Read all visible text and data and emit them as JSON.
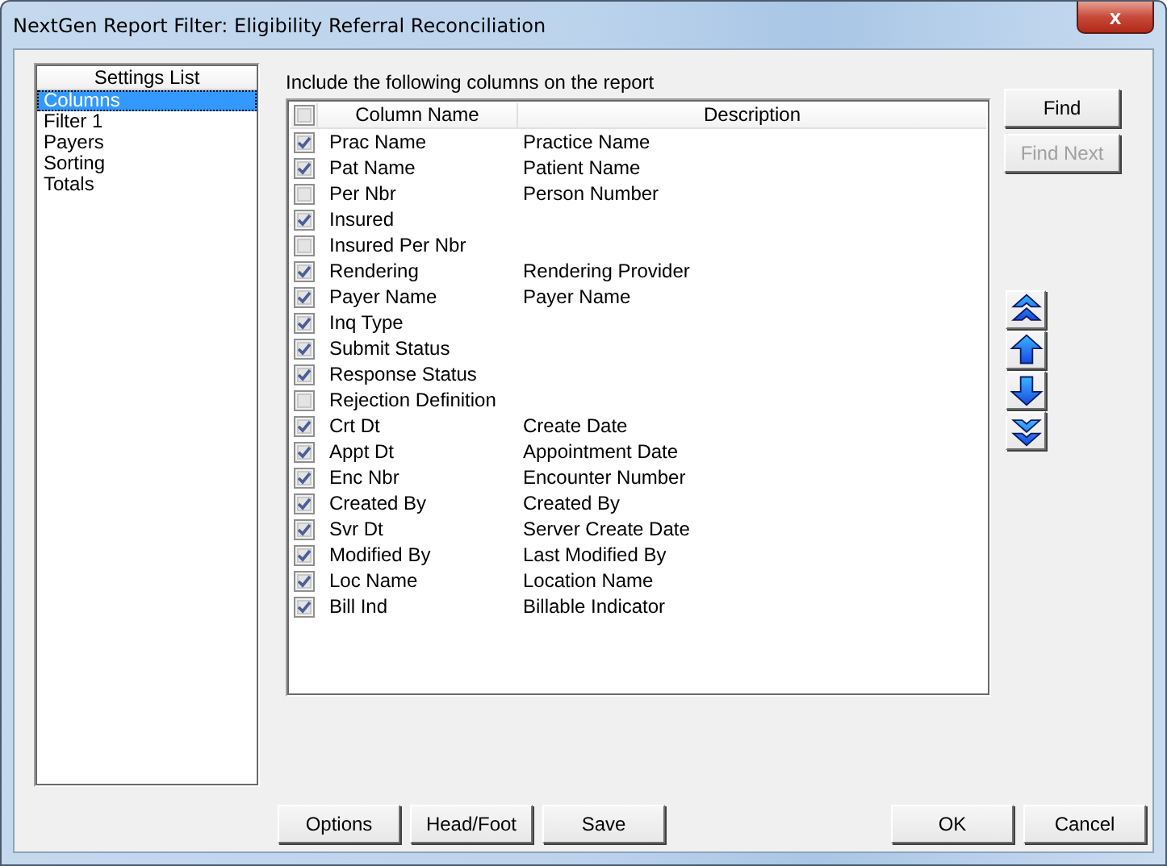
{
  "window": {
    "title": "NextGen Report Filter: Eligibility Referral Reconciliation",
    "close": "x"
  },
  "settings_list": {
    "header": "Settings List",
    "items": [
      {
        "label": "Columns",
        "selected": true
      },
      {
        "label": "Filter 1",
        "selected": false
      },
      {
        "label": "Payers",
        "selected": false
      },
      {
        "label": "Sorting",
        "selected": false
      },
      {
        "label": "Totals",
        "selected": false
      }
    ]
  },
  "columns_label": "Include the following columns on the report",
  "grid": {
    "select_all_checked": false,
    "columns": [
      "Column Name",
      "Description"
    ],
    "rows": [
      {
        "name": "Prac Name",
        "description": "Practice Name",
        "checked": true
      },
      {
        "name": "Pat Name",
        "description": "Patient Name",
        "checked": true
      },
      {
        "name": "Per Nbr",
        "description": "Person Number",
        "checked": false
      },
      {
        "name": "Insured",
        "description": "",
        "checked": true
      },
      {
        "name": "Insured Per Nbr",
        "description": "",
        "checked": false
      },
      {
        "name": "Rendering",
        "description": "Rendering Provider",
        "checked": true
      },
      {
        "name": "Payer Name",
        "description": "Payer Name",
        "checked": true
      },
      {
        "name": "Inq Type",
        "description": "",
        "checked": true
      },
      {
        "name": "Submit Status",
        "description": "",
        "checked": true
      },
      {
        "name": "Response Status",
        "description": "",
        "checked": true
      },
      {
        "name": "Rejection Definition",
        "description": "",
        "checked": false
      },
      {
        "name": "Crt Dt",
        "description": "Create Date",
        "checked": true
      },
      {
        "name": "Appt Dt",
        "description": "Appointment Date",
        "checked": true
      },
      {
        "name": "Enc Nbr",
        "description": "Encounter Number",
        "checked": true
      },
      {
        "name": "Created By",
        "description": "Created By",
        "checked": true
      },
      {
        "name": "Svr Dt",
        "description": "Server Create Date",
        "checked": true
      },
      {
        "name": "Modified By",
        "description": "Last Modified By",
        "checked": true
      },
      {
        "name": "Loc Name",
        "description": "Location Name",
        "checked": true
      },
      {
        "name": "Bill Ind",
        "description": "Billable Indicator",
        "checked": true
      }
    ]
  },
  "side_buttons": [
    {
      "label": "Find",
      "disabled": false
    },
    {
      "label": "Find Next",
      "disabled": true
    }
  ],
  "move_buttons": [
    {
      "kind": "top"
    },
    {
      "kind": "up"
    },
    {
      "kind": "down"
    },
    {
      "kind": "bottom"
    }
  ],
  "bottom_left_buttons": [
    "Options",
    "Head/Foot",
    "Save"
  ],
  "bottom_right_buttons": [
    "OK",
    "Cancel"
  ]
}
